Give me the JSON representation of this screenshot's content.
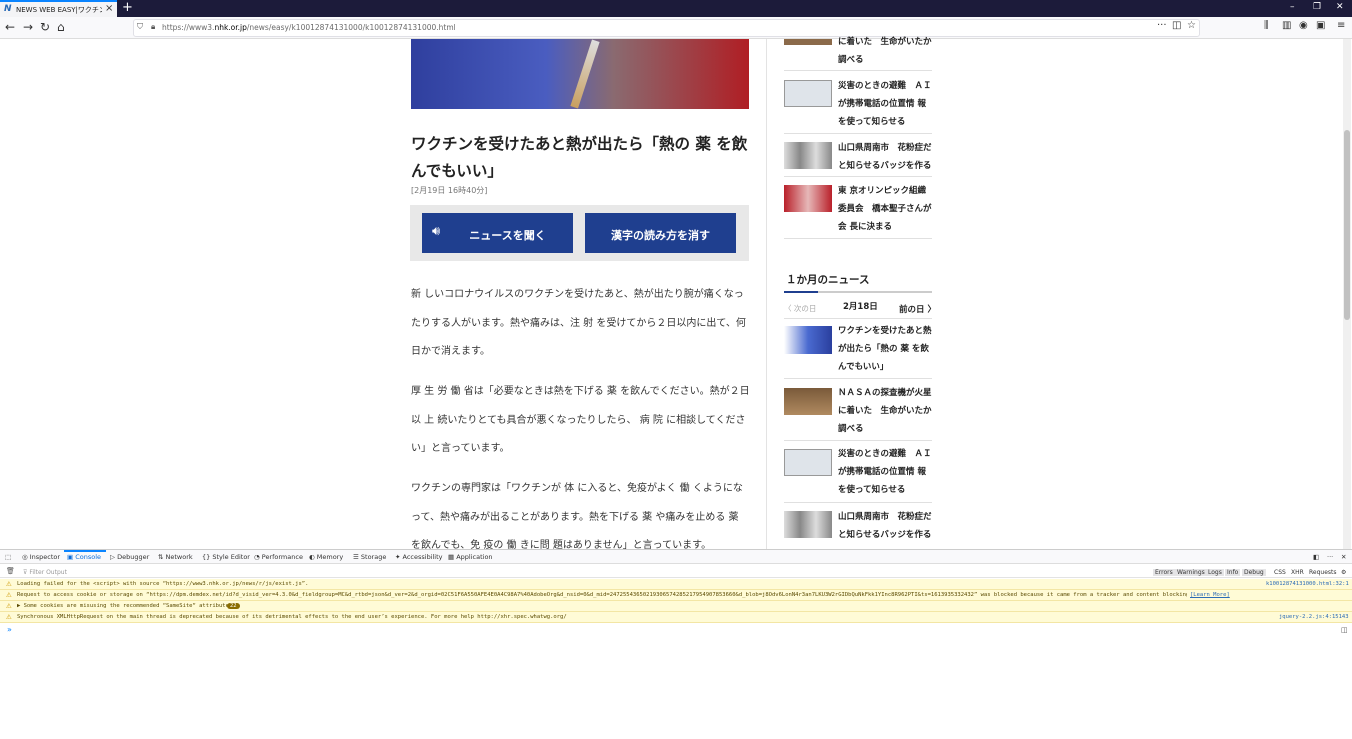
{
  "browser": {
    "tab_title": "NEWS WEB EASY|ワクチンを受",
    "tab_favicon": "N",
    "new_tab": "+",
    "url_prefix": "https://www3.",
    "url_domain": "nhk.or.jp",
    "url_path": "/news/easy/k10012874131000/k10012874131000.html",
    "controls": {
      "minimize": "–",
      "restore": "❐",
      "close": "✕"
    }
  },
  "article": {
    "headline": "ワクチンを受けたあと熱が出たら「熱の 薬 を飲んでもいい」",
    "date": "[2月19日 16時40分]",
    "listen_button": "ニュースを聞く",
    "furigana_button": "漢字の読み方を消す",
    "paragraphs": [
      "新 しいコロナウイルスのワクチンを受けたあと、熱が出たり腕が痛くなったりする人がいます。熱や痛みは、注 射 を受けてから２日以内に出て、何日かで消えます。",
      "厚 生 労 働 省は「必要なときは熱を下げる 薬 を飲んでください。熱が２日以 上 続いたりとても具合が悪くなったりしたら、 病 院 に相談してください」と言っています。",
      "ワクチンの専門家は「ワクチンが 体 に入ると、免疫がよく 働 くようになって、熱や痛みが出ることがあります。熱を下げる 薬 や痛みを止める 薬 を飲んでも、免 疫の 働 きに問 題はありません」と言っています。"
    ],
    "p2_highlight": "厚 生 労 働 省"
  },
  "sidebar": {
    "top_items": [
      "に着いた　生命がいたか調べる",
      "災害のときの避難　ＡＩが携帯電話の位置情 報を使って知らせる",
      "山口県周南市　花粉症だと知らせるバッジを作る",
      "東 京オリンピック組織委員会　橋本聖子さんが会 長に決まる"
    ],
    "month_title": "１か月のニュース",
    "prev_day": "〈 次の日",
    "current_day": "2月18日",
    "next_day": "前の日 〉",
    "month_items": [
      "ワクチンを受けたあと熱が出たら「熱の 薬 を飲んでもいい」",
      "ＮＡＳＡの探査機が火星に着いた　生命がいたか調べる",
      "災害のときの避難　ＡＩが携帯電話の位置情 報を使って知らせる",
      "山口県周南市　花粉症だと知らせるバッジを作る"
    ]
  },
  "devtools": {
    "tabs": [
      "Inspector",
      "Console",
      "Debugger",
      "Network",
      "Style Editor",
      "Performance",
      "Memory",
      "Storage",
      "Accessibility",
      "Application"
    ],
    "filter_placeholder": "Filter Output",
    "filters": [
      "Errors",
      "Warnings",
      "Logs",
      "Info",
      "Debug",
      "CSS",
      "XHR",
      "Requests"
    ],
    "logs": [
      {
        "text": "Loading failed for the <script> with source “https://www3.nhk.or.jp/news/r/js/exist.js”.",
        "source": "k10012874131000.html:32:1"
      },
      {
        "text": "Request to access cookie or storage on “https://dpm.demdex.net/id?d_visid_ver=4.3.0&d_fieldgroup=MC&d_rtbd=json&d_ver=2&d_orgid=02C51F6A550AFE4E0A4C98A7%40AdobeOrg&d_nsid=0&d_mid=24725543650219306574285217954907853660&d_blob=j8Odv6LonN4r3an7LKU3W2rGIDbQuNkFkk1YInc8R962PTI&ts=1613935332432” was blocked because it came from a tracker and content blocking is enabled.",
        "source": "[Learn More]"
      },
      {
        "text": "▶ Some cookies are misusing the recommended “SameSite“ attribute",
        "source": "22"
      },
      {
        "text": "Synchronous XMLHttpRequest on the main thread is deprecated because of its detrimental effects to the end user’s experience. For more help http://xhr.spec.whatwg.org/",
        "source": "jquery-2.2.js:4:15143"
      }
    ],
    "prompt": "»"
  }
}
